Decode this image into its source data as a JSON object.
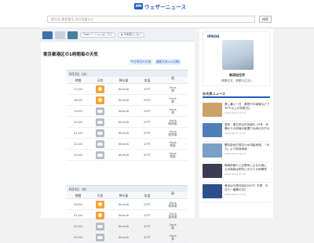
{
  "header": {
    "brand": "ウェザーニュース",
    "search_placeholder": "都市名,郵便番号,市外局番など",
    "search_button": "検索"
  },
  "tabs": {
    "flash_label": "Flashバージョンはこちら",
    "mode_label": "◆ 平地表示しない"
  },
  "forecast": {
    "title": "東京都港区の1時間毎の天気",
    "link_today": "今日明日の天気",
    "link_weekly": "週間天気(10日間)",
    "columns": [
      "時間",
      "天気",
      "降水量",
      "気温",
      "風"
    ],
    "days": [
      {
        "date": "6月3日（水）",
        "rows": [
          {
            "time": "17:00",
            "icon": "sunny-icon",
            "rain": "0mm/h",
            "temp": "25℃",
            "wind": "5m/s\n南"
          },
          {
            "time": "18:00",
            "icon": "sunny-icon",
            "rain": "0mm/h",
            "temp": "25℃",
            "wind": "5m/s\n南"
          },
          {
            "time": "19:00",
            "icon": "cloudy-icon",
            "rain": "0mm/h",
            "temp": "24℃",
            "wind": "5m/s\n南"
          },
          {
            "time": "20:00",
            "icon": "cloudy-icon",
            "rain": "0mm/h",
            "temp": "23℃",
            "wind": "4m/s\n南南東"
          },
          {
            "time": "21:00",
            "icon": "cloudy-icon",
            "rain": "0mm/h",
            "temp": "23℃",
            "wind": "4m/s\n南南東"
          },
          {
            "time": "22:00",
            "icon": "cloudy-icon",
            "rain": "0mm/h",
            "temp": "23℃",
            "wind": "3m/s\n南東"
          },
          {
            "time": "23:00",
            "icon": "cloudy-icon",
            "rain": "0mm/h",
            "temp": "22℃",
            "wind": "3m/s\n南東"
          }
        ]
      },
      {
        "date": "6月4日（木）",
        "rows": [
          {
            "time": "00:00",
            "icon": "sunny-icon",
            "rain": "0mm/h",
            "temp": "22℃",
            "wind": "3m/s\n東南東"
          },
          {
            "time": "01:00",
            "icon": "sunny-icon",
            "rain": "0mm/h",
            "temp": "22℃",
            "wind": "2m/s\n東南東"
          },
          {
            "time": "02:00",
            "icon": "cloudy-icon",
            "rain": "0mm/h",
            "temp": "22℃",
            "wind": "2m/s\n東"
          },
          {
            "time": "03:00",
            "icon": "cloudy-icon",
            "rain": "0mm/h",
            "temp": "22℃",
            "wind": "2m/s\n東"
          }
        ]
      }
    ]
  },
  "ad": {
    "brand": "IPROS",
    "title": "無添加住宅",
    "subtitle": "健康住宅、健康な住まい"
  },
  "news": {
    "heading": "お天気ニュース",
    "items": [
      {
        "text": "蒸し暑い一日　都営や中南東などで30℃以上の真夏日に",
        "date": "2020.06.03 13:10",
        "color": "#c9a36a"
      },
      {
        "text": "週末・東日本は天気崩れ 29号　沖縄からの前線の影響で大雨のおそれ",
        "date": "2020.06.03 12:50",
        "color": "#4f7fb8"
      },
      {
        "text": "関中部地方周辺の水供給地域、「水力」より新潟地域",
        "date": "2020.06.03 12:20",
        "color": "#7aa0c4"
      },
      {
        "text": "梅雨前線や上空寒気による大雨に　九州南部は明日にかけて大雨警戒",
        "date": "2020.06.03 11:40",
        "color": "#3c3c50"
      },
      {
        "text": "東京は今週2回目の30℃ 予想　今日も一番暑の日に",
        "date": "2020.06.03 11:00",
        "color": "#2f4f8a"
      }
    ]
  }
}
